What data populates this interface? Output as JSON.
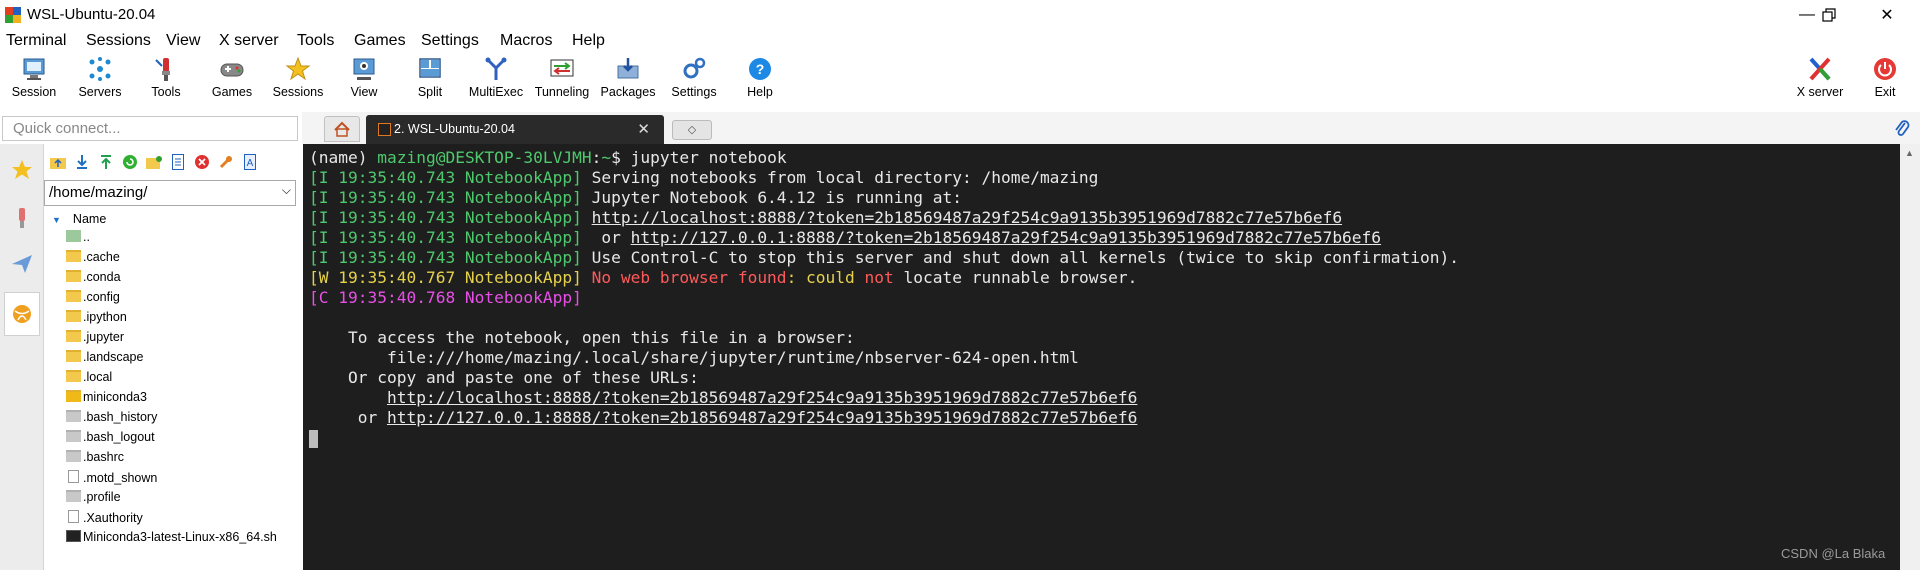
{
  "window": {
    "title": "WSL-Ubuntu-20.04",
    "minimize": "—",
    "restore": "❐",
    "close": "✕"
  },
  "menu": [
    "Terminal",
    "Sessions",
    "View",
    "X server",
    "Tools",
    "Games",
    "Settings",
    "Macros",
    "Help"
  ],
  "toolbar": {
    "items": [
      {
        "label": "Session",
        "icon": "session-icon"
      },
      {
        "label": "Servers",
        "icon": "servers-icon"
      },
      {
        "label": "Tools",
        "icon": "tools-icon"
      },
      {
        "label": "Games",
        "icon": "games-icon"
      },
      {
        "label": "Sessions",
        "icon": "star-icon"
      },
      {
        "label": "View",
        "icon": "view-icon"
      },
      {
        "label": "Split",
        "icon": "split-icon"
      },
      {
        "label": "MultiExec",
        "icon": "multiexec-icon"
      },
      {
        "label": "Tunneling",
        "icon": "tunneling-icon"
      },
      {
        "label": "Packages",
        "icon": "packages-icon"
      },
      {
        "label": "Settings",
        "icon": "settings-icon"
      },
      {
        "label": "Help",
        "icon": "help-icon"
      }
    ],
    "right": [
      {
        "label": "X server",
        "icon": "xserver-icon"
      },
      {
        "label": "Exit",
        "icon": "power-icon"
      }
    ]
  },
  "quick_connect": {
    "placeholder": "Quick connect..."
  },
  "tabs": {
    "active_label": "2. WSL-Ubuntu-20.04",
    "close": "✕",
    "new_tab": "◇"
  },
  "sidebar": {
    "path": "/home/mazing/",
    "header": "Name",
    "files": [
      {
        "name": "..",
        "type": "up"
      },
      {
        "name": ".cache",
        "type": "folder"
      },
      {
        "name": ".conda",
        "type": "folder"
      },
      {
        "name": ".config",
        "type": "folder"
      },
      {
        "name": ".ipython",
        "type": "folder"
      },
      {
        "name": ".jupyter",
        "type": "folder"
      },
      {
        "name": ".landscape",
        "type": "folder"
      },
      {
        "name": ".local",
        "type": "folder"
      },
      {
        "name": "miniconda3",
        "type": "folder-dark"
      },
      {
        "name": ".bash_history",
        "type": "gray"
      },
      {
        "name": ".bash_logout",
        "type": "gray"
      },
      {
        "name": ".bashrc",
        "type": "gray"
      },
      {
        "name": ".motd_shown",
        "type": "doc"
      },
      {
        "name": ".profile",
        "type": "gray"
      },
      {
        "name": ".Xauthority",
        "type": "doc"
      },
      {
        "name": "Miniconda3-latest-Linux-x86_64.sh",
        "type": "shell"
      }
    ]
  },
  "terminal": {
    "prompt_env": "(name) ",
    "prompt_user": "mazing@DESKTOP-30LVJMH",
    "prompt_sep": ":",
    "prompt_path": "~",
    "prompt_end": "$ ",
    "command": "jupyter notebook",
    "log": [
      {
        "tag": "[I 19:35:40.743 NotebookApp]",
        "text": " Serving notebooks from local directory: /home/mazing"
      },
      {
        "tag": "[I 19:35:40.743 NotebookApp]",
        "text": " Jupyter Notebook 6.4.12 is running at:"
      },
      {
        "tag": "[I 19:35:40.743 NotebookApp]",
        "pre": " ",
        "link": "http://localhost:8888/?token=2b18569487a29f254c9a9135b3951969d7882c77e57b6ef6"
      },
      {
        "tag": "[I 19:35:40.743 NotebookApp]",
        "pre": "  or ",
        "link": "http://127.0.0.1:8888/?token=2b18569487a29f254c9a9135b3951969d7882c77e57b6ef6"
      },
      {
        "tag": "[I 19:35:40.743 NotebookApp]",
        "text": " Use Control-C to stop this server and shut down all kernels (twice to skip confirmation)."
      }
    ],
    "warn": {
      "tag": "[W 19:35:40.767 NotebookApp]",
      "part1": " No web browser found",
      "part2": ": could ",
      "part3": "not",
      "part4": " locate runnable browser."
    },
    "crit": {
      "tag": "[C 19:35:40.768 NotebookApp]"
    },
    "access": [
      "    To access the notebook, open this file in a browser:",
      "        file:///home/mazing/.local/share/jupyter/runtime/nbserver-624-open.html",
      "    Or copy and paste one of these URLs:"
    ],
    "url1_pre": "        ",
    "url1": "http://localhost:8888/?token=2b18569487a29f254c9a9135b3951969d7882c77e57b6ef6",
    "url2_pre": "     or ",
    "url2": "http://127.0.0.1:8888/?token=2b18569487a29f254c9a9135b3951969d7882c77e57b6ef6"
  },
  "watermark": "CSDN @La Blaka"
}
